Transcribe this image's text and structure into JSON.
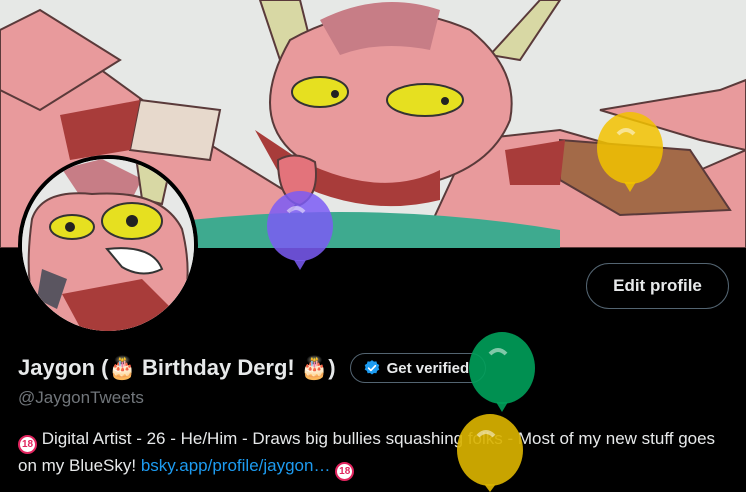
{
  "profile": {
    "display_name": "Jaygon (🎂 Birthday Derg! 🎂)",
    "handle": "@JaygonTweets",
    "edit_profile_label": "Edit profile",
    "get_verified_label": "Get verified",
    "bio": {
      "badge_text": "18",
      "line": "Digital Artist - 26 - He/Him - Draws big bullies squashing folks - Most of my new stuff goes on my BlueSky!",
      "link_text": "bsky.app/profile/jaygon…",
      "badge_end_text": "18"
    }
  },
  "icons": {
    "verified": "verified-badge-icon",
    "balloons": [
      "purple-balloon-icon",
      "yellow-balloon-icon",
      "green-balloon-icon",
      "yellow-balloon-icon"
    ]
  },
  "colors": {
    "background": "#000000",
    "link": "#1d9bf0",
    "muted": "#71767b",
    "balloon_purple": "#7b5cf5",
    "balloon_yellow": "#f2c200",
    "balloon_green": "#00a05a"
  }
}
